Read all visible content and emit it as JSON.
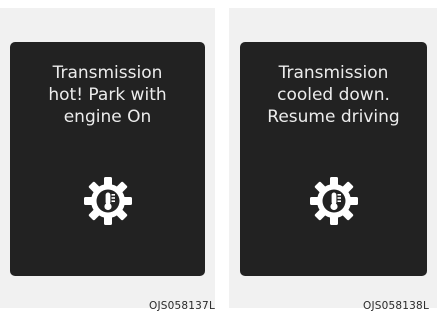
{
  "panels": [
    {
      "message": "Transmission\nhot! Park with\nengine On",
      "icon": "transmission-temperature-gear-icon",
      "code": "OJS058137L"
    },
    {
      "message": "Transmission\ncooled down.\nResume driving",
      "icon": "transmission-temperature-gear-icon",
      "code": "OJS058138L"
    }
  ],
  "colors": {
    "panel_background": "#f1f1f1",
    "screen_background": "#222222",
    "text_on_screen": "#ececec",
    "caption_text": "#2a2a2a"
  }
}
